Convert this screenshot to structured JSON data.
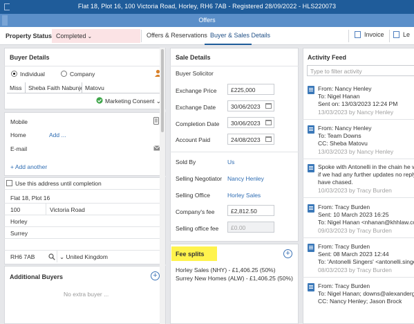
{
  "titlebar": {
    "text": "Flat 18, Plot 16, 100 Victoria Road, Horley, RH6 7AB - Registered 28/09/2022 - HLS220073"
  },
  "window": {
    "title": "Offers"
  },
  "property_status": {
    "label": "Property Status",
    "value": "Completed"
  },
  "tabs": [
    {
      "label": "Offers & Reservations",
      "active": false
    },
    {
      "label": "Buyer & Sales Details",
      "active": true
    }
  ],
  "toolbar": {
    "invoice_label": "Invoice",
    "le_label": "Le"
  },
  "buyer": {
    "title": "Buyer Details",
    "type_individual": "Individual",
    "type_company": "Company",
    "selected_type": "Individual",
    "title_value": "Miss",
    "forenames": "Sheba Faith Nabunje",
    "surname": "Matovu",
    "marketing_consent": "Marketing Consent",
    "mobile_label": "Mobile",
    "home_label": "Home",
    "home_add": "Add ...",
    "email_label": "E-mail",
    "add_another": "+ Add another",
    "use_address_label": "Use this address until completion",
    "address_line1": "Flat 18, Plot 16",
    "house_no": "100",
    "street": "Victoria Road",
    "town": "Horley",
    "county": "Surrey",
    "postcode": "RH6 7AB",
    "country": "United Kingdom"
  },
  "additional_buyers": {
    "title": "Additional Buyers",
    "empty": "No extra buyer ..."
  },
  "sale": {
    "title": "Sale Details",
    "buyer_solicitor_label": "Buyer Solicitor",
    "exchange_price_label": "Exchange Price",
    "exchange_price": "£225,000",
    "exchange_date_label": "Exchange Date",
    "exchange_date": "30/06/2023",
    "completion_date_label": "Completion Date",
    "completion_date": "30/06/2023",
    "account_paid_label": "Account Paid",
    "account_paid": "24/08/2023",
    "sold_by_label": "Sold By",
    "sold_by": "Us",
    "selling_negotiator_label": "Selling Negotiator",
    "selling_negotiator": "Nancy Henley",
    "selling_office_label": "Selling Office",
    "selling_office": "Horley Sales",
    "company_fee_label": "Company's fee",
    "company_fee": "£2,812.50",
    "selling_office_fee_label": "Selling office fee",
    "selling_office_fee": "£0.00"
  },
  "fee_splits": {
    "title": "Fee splits",
    "rows": [
      "Horley Sales (NHY) - £1,406.25 (50%)",
      "Surrey New Homes (ALW) - £1,406.25 (50%)"
    ]
  },
  "activity": {
    "title": "Activity Feed",
    "filter_placeholder": "Type to filter activity",
    "items": [
      {
        "lines": [
          "From: Nancy Henley",
          "To: Nigel Hanan",
          "Sent on: 13/03/2023 12:24 PM"
        ],
        "meta": "13/03/2023 by Nancy Henley"
      },
      {
        "lines": [
          "From: Nancy Henley",
          "To: Team Downs",
          "CC: Sheba Matovu"
        ],
        "meta": "13/03/2023 by Nancy Henley"
      },
      {
        "lines": [
          "Spoke with Antonelli in the chain he w",
          "if we had any further updates no reply",
          "have chased."
        ],
        "meta": "10/03/2023 by Tracy Burden"
      },
      {
        "lines": [
          "From: Tracy Burden",
          "Sent: 10 March 2023 16:25",
          "To: Nigel Hanan <nhanan@khhlaw.co."
        ],
        "meta": "09/03/2023 by Tracy Burden"
      },
      {
        "lines": [
          "From: Tracy Burden",
          "Sent: 08 March 2023 12:44",
          "To: 'Antonelli Singers' <antonelli.singer"
        ],
        "meta": "08/03/2023 by Tracy Burden"
      },
      {
        "lines": [
          "From: Tracy Burden",
          "To: Nigel Hanan; downs@alexandergra",
          "CC: Nancy Henley; Jason Brock"
        ],
        "meta": ""
      }
    ]
  },
  "colors": {
    "titlebar": "#1f5c9a",
    "accent": "#2f6db3",
    "status_bg": "#fbe3e5",
    "highlight": "#fff34d"
  }
}
